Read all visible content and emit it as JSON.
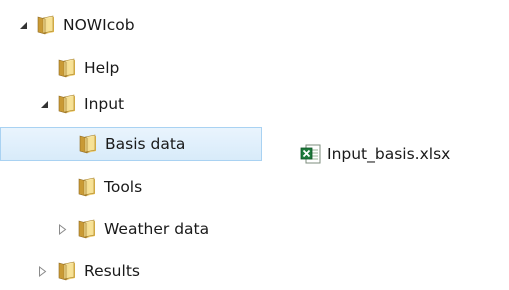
{
  "tree": {
    "items": [
      {
        "label": "NOWIcob",
        "expanded": true,
        "has_children": true
      },
      {
        "label": "Help",
        "has_children": false
      },
      {
        "label": "Input",
        "expanded": true,
        "has_children": true
      },
      {
        "label": "Basis data",
        "selected": true,
        "has_children": false
      },
      {
        "label": "Tools",
        "has_children": false
      },
      {
        "label": "Weather data",
        "expanded": false,
        "has_children": true
      },
      {
        "label": "Results",
        "expanded": false,
        "has_children": true
      }
    ]
  },
  "files": {
    "items": [
      {
        "label": "Input_basis.xlsx",
        "icon": "excel-file-icon"
      }
    ]
  },
  "colors": {
    "selection": "#d8ebfa",
    "selection_border": "#a9d2f2",
    "folder": "#e8c250",
    "excel": "#1d7a3b"
  }
}
